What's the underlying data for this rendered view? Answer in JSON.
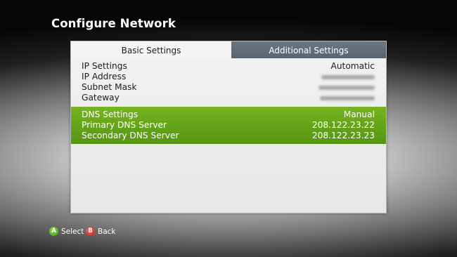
{
  "page_title": "Configure Network",
  "tabs": [
    {
      "label": "Basic Settings",
      "selected": true
    },
    {
      "label": "Additional Settings",
      "selected": false
    }
  ],
  "ip_section": {
    "settings_label": "IP Settings",
    "settings_value": "Automatic",
    "address_label": "IP Address",
    "subnet_label": "Subnet Mask",
    "gateway_label": "Gateway"
  },
  "dns_section": {
    "settings_label": "DNS Settings",
    "settings_value": "Manual",
    "primary_label": "Primary DNS Server",
    "primary_value": "208.122.23.22",
    "secondary_label": "Secondary DNS Server",
    "secondary_value": "208.122.23.23"
  },
  "footer": {
    "a_glyph": "A",
    "a_label": "Select",
    "b_glyph": "B",
    "b_label": "Back"
  },
  "colors": {
    "selection_green": "#6aab1c",
    "tab_inactive": "#5f6f7a",
    "button_a": "#4caf1e",
    "button_b": "#d0261a"
  }
}
